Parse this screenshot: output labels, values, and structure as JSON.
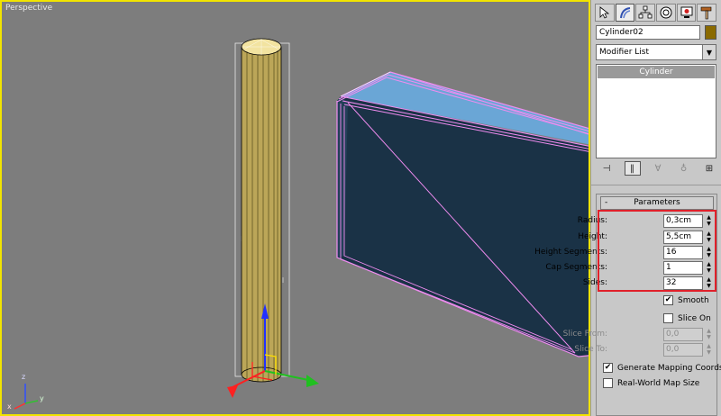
{
  "viewport": {
    "label": "Perspective",
    "axis_labels": {
      "z": "z",
      "y": "y",
      "x": "x"
    }
  },
  "panel": {
    "tabs": [
      {
        "name": "create-tab",
        "icon": "pointer-create-icon"
      },
      {
        "name": "modify-tab",
        "icon": "bend-arc-icon"
      },
      {
        "name": "hierarchy-tab",
        "icon": "hierarchy-icon"
      },
      {
        "name": "motion-tab",
        "icon": "motion-circle-icon"
      },
      {
        "name": "display-tab",
        "icon": "display-monitor-icon"
      },
      {
        "name": "utilities-tab",
        "icon": "hammer-icon"
      }
    ],
    "object_name": "Cylinder02",
    "object_color": "#8a6a00",
    "modifier_list": "Modifier List",
    "stack_items": [
      "Cylinder"
    ]
  },
  "parameters": {
    "title": "Parameters",
    "collapse_symbol": "-",
    "radius": {
      "label": "Radius:",
      "value": "0,3cm"
    },
    "height": {
      "label": "Height:",
      "value": "5,5cm"
    },
    "height_segments": {
      "label": "Height Segments:",
      "value": "16"
    },
    "cap_segments": {
      "label": "Cap Segments:",
      "value": "1"
    },
    "sides": {
      "label": "Sides:",
      "value": "32"
    },
    "smooth": {
      "label": "Smooth",
      "checked": true
    },
    "slice_on": {
      "label": "Slice On",
      "checked": false
    },
    "slice_from": {
      "label": "Slice From:",
      "value": "0,0"
    },
    "slice_to": {
      "label": "Slice To:",
      "value": "0,0"
    },
    "generate_mapping": {
      "label": "Generate Mapping Coords.",
      "checked": true
    },
    "real_world": {
      "label": "Real-World Map Size",
      "checked": false
    }
  },
  "colors": {
    "viewport_bg": "#7d7d7d",
    "active_border": "#f2e400",
    "selection_highlight": "#e0202a",
    "box_top": "#6aa6d6",
    "box_front": "#1a3246",
    "box_wire": "#f08cf0"
  }
}
